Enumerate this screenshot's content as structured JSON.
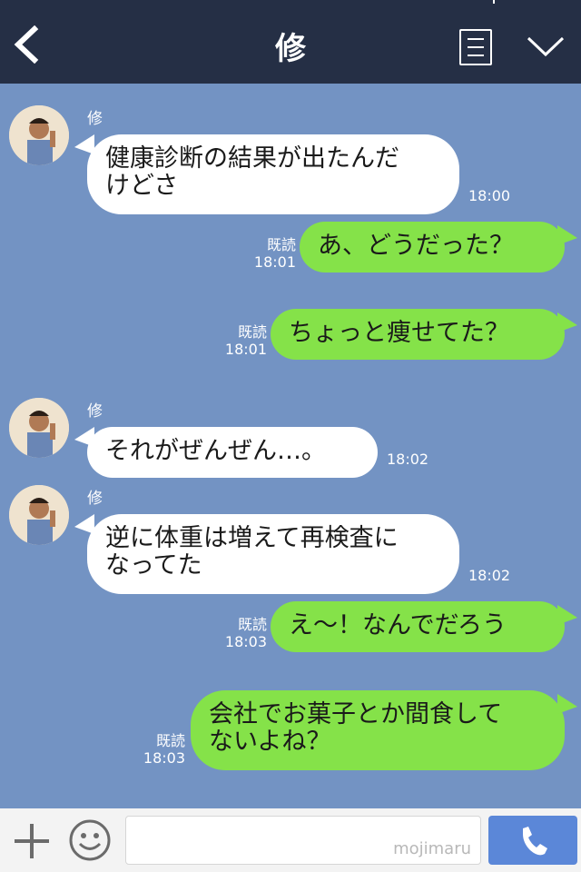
{
  "header": {
    "title": "修"
  },
  "messages": [
    {
      "type": "in",
      "sender": "修",
      "lines": [
        "健康診断の結果が出たんだ",
        "けどさ"
      ],
      "time": "18:00"
    },
    {
      "type": "out",
      "text": "あ、どうだった？",
      "read_label": "既読",
      "time": "18:01"
    },
    {
      "type": "out",
      "text": "ちょっと痩せてた？",
      "read_label": "既読",
      "time": "18:01"
    },
    {
      "type": "in",
      "sender": "修",
      "lines": [
        "それがぜんぜん…。"
      ],
      "time": "18:02"
    },
    {
      "type": "in",
      "sender": "修",
      "lines": [
        "逆に体重は増えて再検査に",
        "なってた"
      ],
      "time": "18:02"
    },
    {
      "type": "out",
      "text": "え〜！なんでだろう",
      "read_label": "既読",
      "time": "18:03"
    },
    {
      "type": "out",
      "lines": [
        "会社でお菓子とか間食して",
        "ないよね？"
      ],
      "read_label": "既読",
      "time": "18:03"
    }
  ],
  "footer": {
    "input_value": "",
    "watermark": "mojimaru"
  },
  "icons": {
    "back": "back-arrow-icon",
    "menu": "menu-icon",
    "collapse": "chevron-down-icon",
    "plus": "plus-icon",
    "sticker": "smile-icon",
    "call": "phone-icon"
  },
  "colors": {
    "header_bg": "#252f45",
    "chat_bg": "#7393c3",
    "incoming_bubble": "#ffffff",
    "outgoing_bubble": "#85e249",
    "call_button": "#5b87d8"
  }
}
